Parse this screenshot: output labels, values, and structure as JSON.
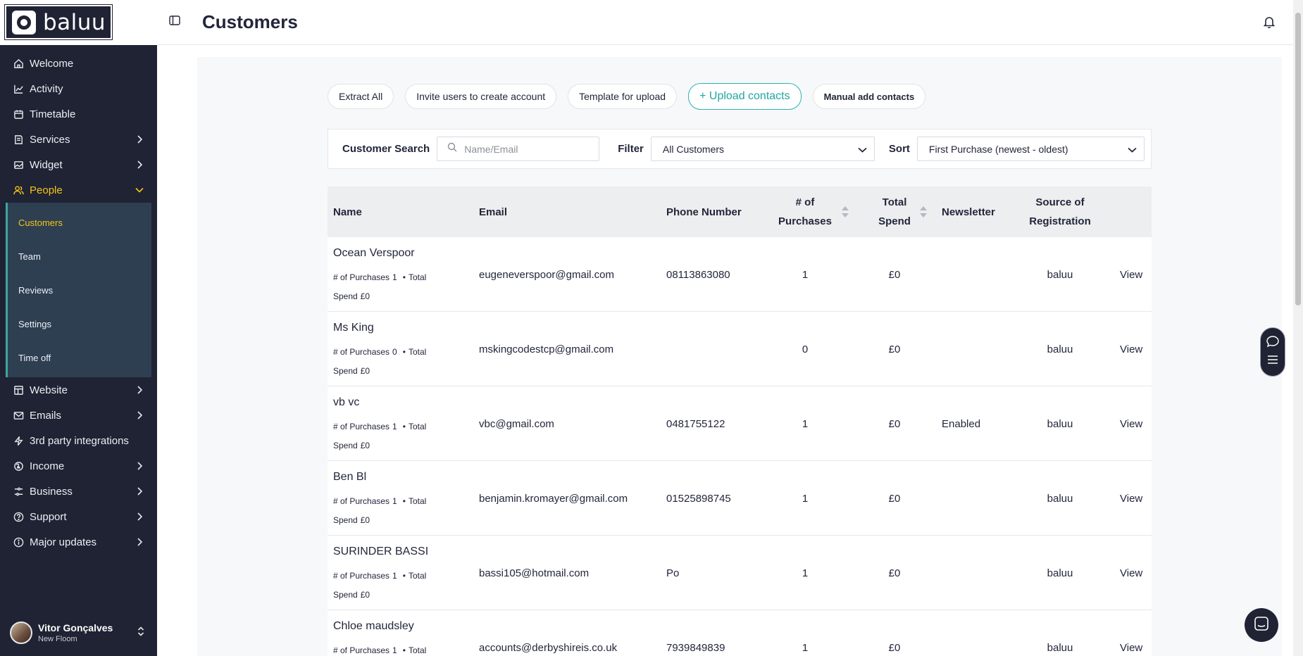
{
  "app": {
    "logo_text": "baluu",
    "page_title": "Customers"
  },
  "sidebar": {
    "items": [
      {
        "label": "Welcome",
        "icon": "home-icon"
      },
      {
        "label": "Activity",
        "icon": "chart-icon"
      },
      {
        "label": "Timetable",
        "icon": "calendar-icon"
      },
      {
        "label": "Services",
        "icon": "book-icon"
      },
      {
        "label": "Widget",
        "icon": "image-icon"
      },
      {
        "label": "People",
        "icon": "people-icon"
      },
      {
        "label": "Website",
        "icon": "layout-icon"
      },
      {
        "label": "Emails",
        "icon": "mail-icon"
      },
      {
        "label": "3rd party integrations",
        "icon": "bolt-icon"
      },
      {
        "label": "Income",
        "icon": "coin-icon"
      },
      {
        "label": "Business",
        "icon": "sliders-icon"
      },
      {
        "label": "Support",
        "icon": "help-icon"
      },
      {
        "label": "Major updates",
        "icon": "info-icon"
      }
    ],
    "people_sub": [
      "Customers",
      "Team",
      "Reviews",
      "Settings",
      "Time off"
    ],
    "user": {
      "name": "Vitor Gonçalves",
      "sub": "New Floom"
    }
  },
  "actions": {
    "extract": "Extract All",
    "invite": "Invite users to create account",
    "template": "Template for upload",
    "upload": "+ Upload contacts",
    "manual": "Manual add contacts"
  },
  "filters": {
    "search_label": "Customer Search",
    "search_placeholder": "Name/Email",
    "filter_label": "Filter",
    "filter_value": "All Customers",
    "sort_label": "Sort",
    "sort_value": "First Purchase (newest - oldest)"
  },
  "table": {
    "headers": {
      "name": "Name",
      "email": "Email",
      "phone": "Phone Number",
      "purchases_1": "# of",
      "purchases_2": "Purchases",
      "spend_1": "Total",
      "spend_2": "Spend",
      "newsletter": "Newsletter",
      "source_1": "Source of",
      "source_2": "Registration"
    },
    "meta": {
      "purchases": "# of Purchases",
      "total": "Total",
      "spend": "Spend",
      "view": "View"
    },
    "rows": [
      {
        "name": "Ocean Verspoor",
        "email": "eugeneverspoor@gmail.com",
        "phone": "08113863080",
        "purchases": "1",
        "spend": "£0",
        "newsletter": "",
        "source": "baluu"
      },
      {
        "name": "Ms King",
        "email": "mskingcodestcp@gmail.com",
        "phone": "",
        "purchases": "0",
        "spend": "£0",
        "newsletter": "",
        "source": "baluu"
      },
      {
        "name": "vb vc",
        "email": "vbc@gmail.com",
        "phone": "0481755122",
        "purchases": "1",
        "spend": "£0",
        "newsletter": "Enabled",
        "source": "baluu"
      },
      {
        "name": "Ben Bl",
        "email": "benjamin.kromayer@gmail.com",
        "phone": "01525898745",
        "purchases": "1",
        "spend": "£0",
        "newsletter": "",
        "source": "baluu"
      },
      {
        "name": "SURINDER BASSI",
        "email": "bassi105@hotmail.com",
        "phone": "Po",
        "purchases": "1",
        "spend": "£0",
        "newsletter": "",
        "source": "baluu"
      },
      {
        "name": "Chloe maudsley",
        "email": "accounts@derbyshireis.co.uk",
        "phone": "7939849839",
        "purchases": "1",
        "spend": "£0",
        "newsletter": "",
        "source": "baluu"
      }
    ]
  },
  "colors": {
    "sidebar": "#1f2333",
    "accent": "#f5c518",
    "teal": "#2bb3ad"
  }
}
